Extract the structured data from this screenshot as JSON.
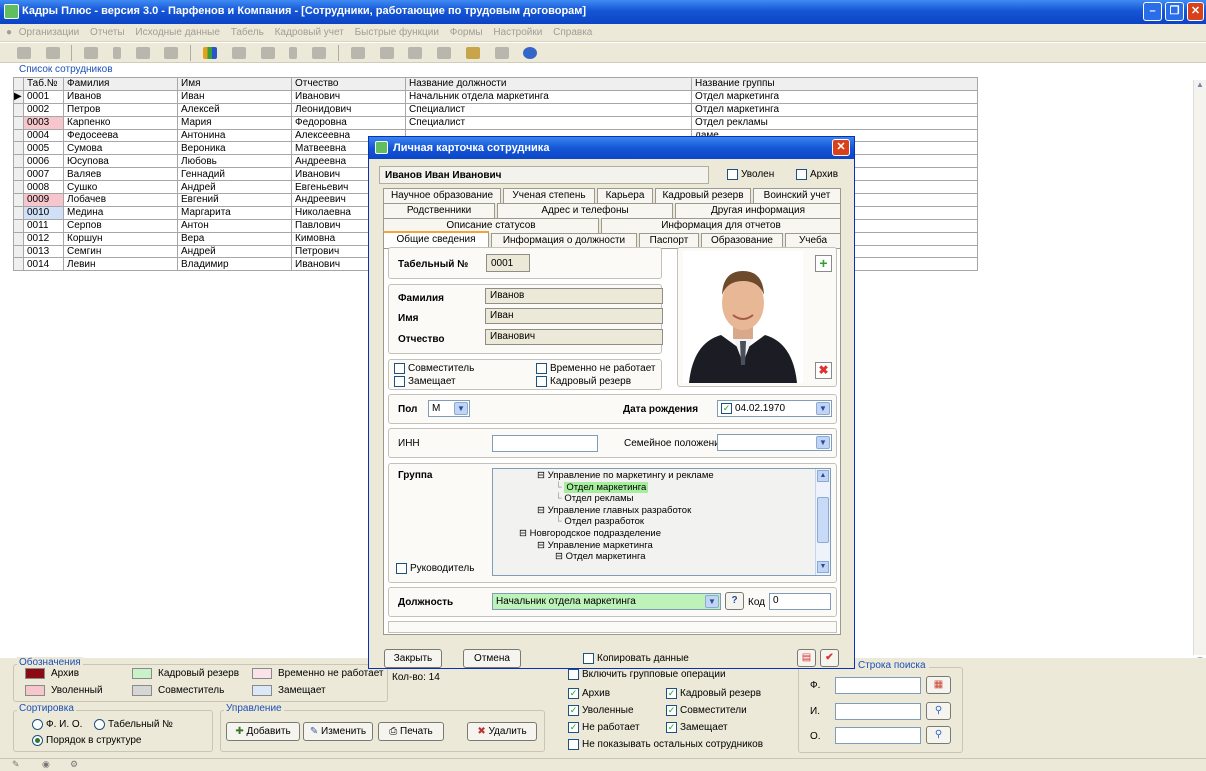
{
  "window": {
    "title": "Кадры Плюс - версия 3.0 - Парфенов и Компания - [Сотрудники, работающие по трудовым договорам]"
  },
  "menu": [
    "Организации",
    "Отчеты",
    "Исходные данные",
    "Табель",
    "Кадровый учет",
    "Быстрые функции",
    "Формы",
    "Настройки",
    "Справка"
  ],
  "list": {
    "caption": "Список сотрудников",
    "columns": [
      "Таб.№",
      "Фамилия",
      "Имя",
      "Отчество",
      "Название должности",
      "Название группы"
    ],
    "rows": [
      [
        "0001",
        "Иванов",
        "Иван",
        "Иванович",
        "Начальник отдела маркетинга",
        "Отдел маркетинга"
      ],
      [
        "0002",
        "Петров",
        "Алексей",
        "Леонидович",
        "Специалист",
        "Отдел маркетинга"
      ],
      [
        "0003",
        "Карпенко",
        "Мария",
        "Федоровна",
        "Специалист",
        "Отдел рекламы"
      ],
      [
        "0004",
        "Федосеева",
        "Антонина",
        "Алексеевна",
        "",
        "ламе"
      ],
      [
        "0005",
        "Сумова",
        "Вероника",
        "Матвеевна",
        "",
        ""
      ],
      [
        "0006",
        "Юсупова",
        "Любовь",
        "Андреевна",
        "",
        ""
      ],
      [
        "0007",
        "Валяев",
        "Геннадий",
        "Иванович",
        "",
        ""
      ],
      [
        "0008",
        "Сушко",
        "Андрей",
        "Евгеньевич",
        "",
        ""
      ],
      [
        "0009",
        "Лобачев",
        "Евгений",
        "Андреевич",
        "",
        ""
      ],
      [
        "0010",
        "Медина",
        "Маргарита",
        "Николаевна",
        "",
        ""
      ],
      [
        "0011",
        "Серпов",
        "Антон",
        "Павлович",
        "",
        ""
      ],
      [
        "0012",
        "Коршун",
        "Вера",
        "Кимовна",
        "",
        ""
      ],
      [
        "0013",
        "Семгин",
        "Андрей",
        "Петрович",
        "",
        ""
      ],
      [
        "0014",
        "Левин",
        "Владимир",
        "Иванович",
        "",
        ""
      ]
    ]
  },
  "legend": {
    "caption": "Обозначения",
    "archive": "Архив",
    "reserve": "Кадровый резерв",
    "not_working": "Временно не работает",
    "fired": "Уволенный",
    "combiner": "Совместитель",
    "replaces": "Замещает",
    "count_label": "Кол-во: 14",
    "colors": {
      "archive": "#8b0a14",
      "reserve": "#c8f2c8",
      "not_working": "#fbe3ea",
      "fired": "#f7c6cc",
      "combiner": "#d6d6d6",
      "replaces": "#dce8f8"
    }
  },
  "sorting": {
    "caption": "Сортировка",
    "fio": "Ф. И. О.",
    "tabno": "Табельный №",
    "structure": "Порядок в структуре"
  },
  "manage": {
    "caption": "Управление",
    "add": "Добавить",
    "edit": "Изменить",
    "print": "Печать",
    "delete": "Удалить"
  },
  "filters": {
    "group_ops": "Включить групповые операции",
    "archive": "Архив",
    "reserve": "Кадровый резерв",
    "fired": "Уволенные",
    "combiners": "Совместители",
    "not_working": "Не работает",
    "replaces": "Замещает",
    "hide_others": "Не показывать остальных сотрудников"
  },
  "search": {
    "caption": "Строка поиска",
    "f": "Ф.",
    "i": "И.",
    "o": "О."
  },
  "dialog": {
    "title": "Личная карточка сотрудника",
    "name": "Иванов Иван Иванович",
    "fired": "Уволен",
    "archive": "Архив",
    "tabs_row1": [
      "Научное образование",
      "Ученая степень",
      "Карьера",
      "Кадровый резерв",
      "Воинский учет"
    ],
    "tabs_row2": [
      "Родственники",
      "Адрес и телефоны",
      "Другая информация"
    ],
    "tabs_row3": [
      "Описание статусов",
      "Информация для отчетов"
    ],
    "tabs_row4": [
      "Общие сведения",
      "Информация о должности",
      "Паспорт",
      "Образование",
      "Учеба"
    ],
    "tabno_label": "Табельный №",
    "tabno_value": "0001",
    "surname_label": "Фамилия",
    "surname_value": "Иванов",
    "firstname_label": "Имя",
    "firstname_value": "Иван",
    "patronymic_label": "Отчество",
    "patronymic_value": "Иванович",
    "combiner": "Совместитель",
    "not_working": "Временно не работает",
    "replaces": "Замещает",
    "reserve": "Кадровый резерв",
    "gender_label": "Пол",
    "gender_value": "М",
    "birth_label": "Дата рождения",
    "birth_value": "04.02.1970",
    "inn_label": "ИНН",
    "marital_label": "Семейное положение",
    "group_label": "Группа",
    "head_label": "Руководитель",
    "tree": [
      "Управление по маркетингу и рекламе",
      "Отдел маркетинга",
      "Отдел рекламы",
      "Управление главных разработок",
      "Отдел разработок",
      "Новгородское подразделение",
      "Управление маркетинга",
      "Отдел маркетинга"
    ],
    "position_label": "Должность",
    "position_value": "Начальник отдела маркетинга",
    "code_label": "Код",
    "code_value": "0",
    "help": "?",
    "close": "Закрыть",
    "cancel": "Отмена",
    "copy": "Копировать данные"
  }
}
